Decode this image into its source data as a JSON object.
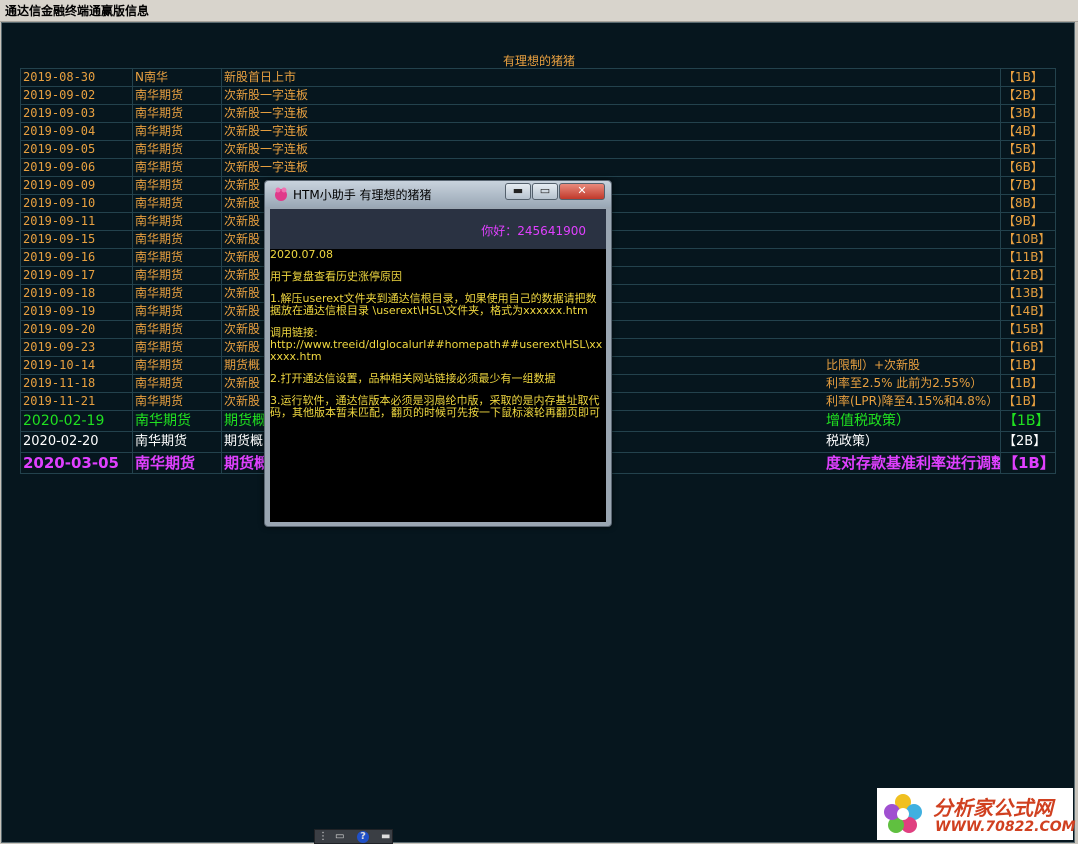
{
  "window": {
    "title": "通达信金融终端通赢版信息"
  },
  "page": {
    "heading": "有理想的猪猪"
  },
  "rows": [
    {
      "date": "2019-08-30",
      "name": "N南华",
      "desc": "新股首日上市",
      "tag": "【1B】",
      "style": "orange"
    },
    {
      "date": "2019-09-02",
      "name": "南华期货",
      "desc": "次新股一字连板",
      "tag": "【2B】",
      "style": "orange"
    },
    {
      "date": "2019-09-03",
      "name": "南华期货",
      "desc": "次新股一字连板",
      "tag": "【3B】",
      "style": "orange"
    },
    {
      "date": "2019-09-04",
      "name": "南华期货",
      "desc": "次新股一字连板",
      "tag": "【4B】",
      "style": "orange"
    },
    {
      "date": "2019-09-05",
      "name": "南华期货",
      "desc": "次新股一字连板",
      "tag": "【5B】",
      "style": "orange"
    },
    {
      "date": "2019-09-06",
      "name": "南华期货",
      "desc": "次新股一字连板",
      "tag": "【6B】",
      "style": "orange"
    },
    {
      "date": "2019-09-09",
      "name": "南华期货",
      "desc": "次新股",
      "tag": "【7B】",
      "style": "orange"
    },
    {
      "date": "2019-09-10",
      "name": "南华期货",
      "desc": "次新股",
      "tag": "【8B】",
      "style": "orange"
    },
    {
      "date": "2019-09-11",
      "name": "南华期货",
      "desc": "次新股",
      "tag": "【9B】",
      "style": "orange"
    },
    {
      "date": "2019-09-15",
      "name": "南华期货",
      "desc": "次新股",
      "tag": "【10B】",
      "style": "orange"
    },
    {
      "date": "2019-09-16",
      "name": "南华期货",
      "desc": "次新股",
      "tag": "【11B】",
      "style": "orange"
    },
    {
      "date": "2019-09-17",
      "name": "南华期货",
      "desc": "次新股",
      "tag": "【12B】",
      "style": "orange"
    },
    {
      "date": "2019-09-18",
      "name": "南华期货",
      "desc": "次新股",
      "tag": "【13B】",
      "style": "orange"
    },
    {
      "date": "2019-09-19",
      "name": "南华期货",
      "desc": "次新股",
      "tag": "【14B】",
      "style": "orange"
    },
    {
      "date": "2019-09-20",
      "name": "南华期货",
      "desc": "次新股",
      "tag": "【15B】",
      "style": "orange"
    },
    {
      "date": "2019-09-23",
      "name": "南华期货",
      "desc": "次新股",
      "tag": "【16B】",
      "style": "orange"
    },
    {
      "date": "2019-10-14",
      "name": "南华期货",
      "desc": "期货概",
      "tail": "比限制）+次新股",
      "tag": "【1B】",
      "style": "orange"
    },
    {
      "date": "2019-11-18",
      "name": "南华期货",
      "desc": "次新股",
      "tail": "利率至2.5% 此前为2.55%）",
      "tag": "【1B】",
      "style": "orange"
    },
    {
      "date": "2019-11-21",
      "name": "南华期货",
      "desc": "次新股",
      "tail": "利率(LPR)降至4.15%和4.8%）",
      "tag": "【1B】",
      "style": "orange"
    },
    {
      "date": "2020-02-19",
      "name": "南华期货",
      "desc": "期货概",
      "tail": "增值税政策）",
      "tag": "【1B】",
      "style": "green"
    },
    {
      "date": "2020-02-20",
      "name": "南华期货",
      "desc": "期货概",
      "tail": "税政策）",
      "tag": "【2B】",
      "style": "white"
    },
    {
      "date": "2020-03-05",
      "name": "南华期货",
      "desc": "期货概",
      "tail": "度对存款基准利率进行调整）",
      "tag": "【1B】",
      "style": "purple"
    }
  ],
  "popup": {
    "title": "HTM小助手    有理想的猪猪",
    "min_label": "▬",
    "max_label": "▭",
    "close_label": "✕",
    "greeting": "你好：245641900",
    "body": [
      "2020.07.08",
      "",
      "用于复盘查看历史涨停原因",
      "",
      "1.解压userext文件夹到通达信根目录，如果使用自己的数据请把数据放在通达信根目录 \\userext\\HSL\\文件夹，格式为xxxxxx.htm",
      "",
      "调用链接:",
      "http://www.treeid/dlglocalurl##homepath##userext\\HSL\\xxxxxx.htm",
      "",
      "2.打开通达信设置，品种相关网站链接必须最少有一组数据",
      "",
      "3.运行软件，通达信版本必须是羽扇纶巾版，采取的是内存基址取代码，其他版本暂未匹配，翻页的时候可先按一下鼠标滚轮再翻页即可"
    ]
  },
  "taskbar": {
    "help_label": "?"
  },
  "watermark": {
    "line1": "分析家公式网",
    "line2": "WWW.70822.COM"
  },
  "colors": {
    "orange": "#e8a040",
    "green": "#20e020",
    "purple": "#e040ff",
    "background": "#06161e"
  }
}
